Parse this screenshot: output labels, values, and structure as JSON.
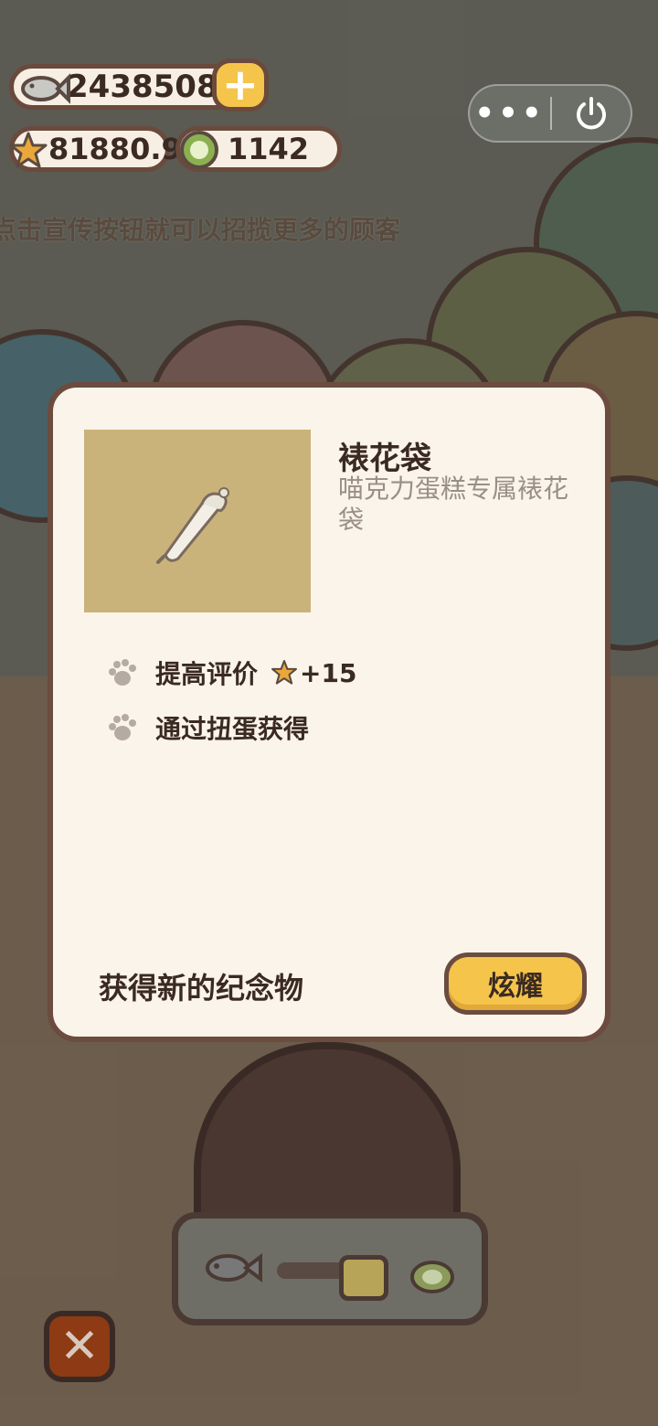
{
  "hud": {
    "fish_coins": "2438508",
    "stars": "81880.9",
    "green_coins": "1142",
    "hint_text": "点击宣传按钮就可以招揽更多的顾客"
  },
  "modal": {
    "item_name": "裱花袋",
    "item_description": "喵克力蛋糕专属裱花袋",
    "attributes": [
      {
        "label": "提高评价",
        "bonus": "+15"
      },
      {
        "label": "通过扭蛋获得"
      }
    ],
    "footer_text": "获得新的纪念物",
    "show_button_label": "炫耀"
  },
  "colors": {
    "accent_yellow": "#f5c44a",
    "outline_brown": "#6b4c3f",
    "modal_bg": "#fbf4ea",
    "close_red": "#8e3a14"
  },
  "icons": [
    "fish-icon",
    "plus-icon",
    "star-icon",
    "green-coin-icon",
    "more-icon",
    "power-icon",
    "piping-bag-icon",
    "paw-icon",
    "close-icon"
  ]
}
